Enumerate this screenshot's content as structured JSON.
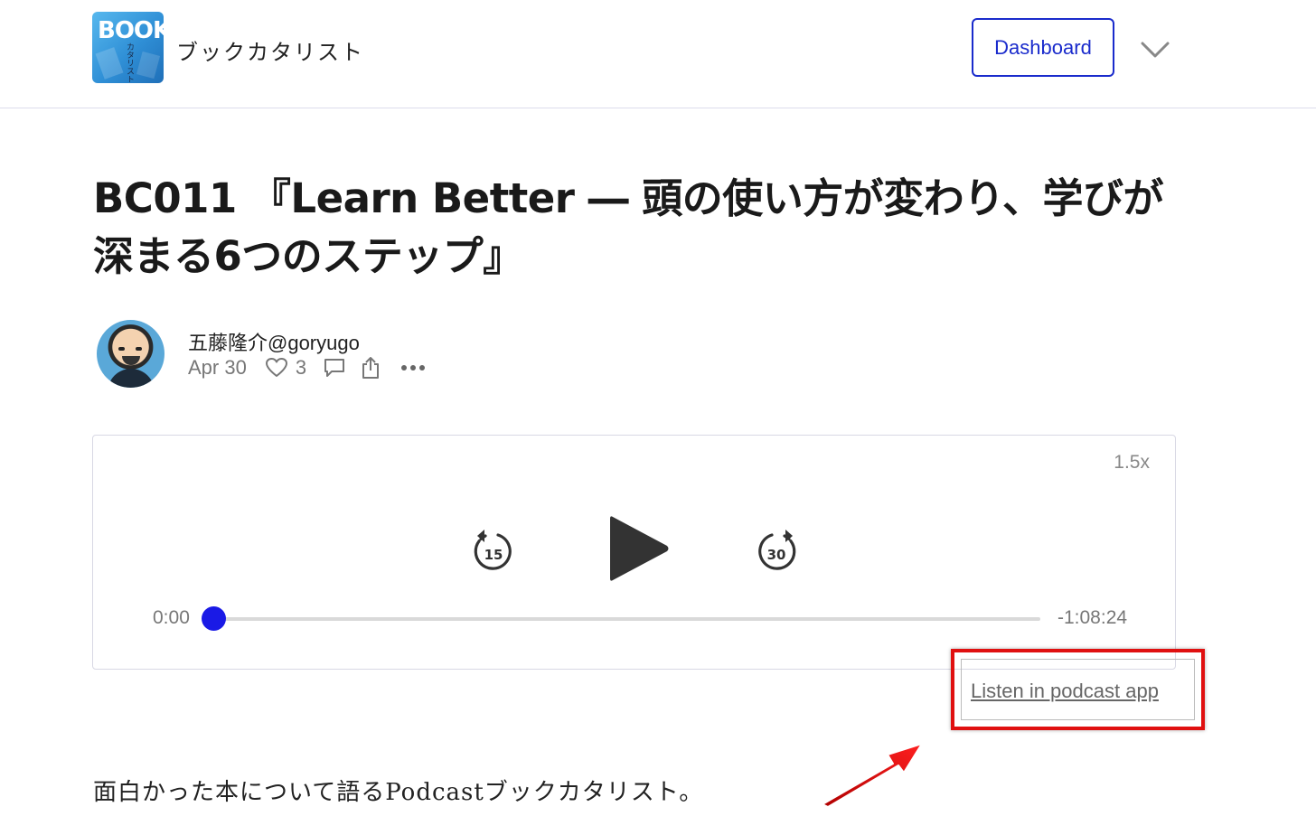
{
  "header": {
    "logo_text": "BOOK",
    "logo_sub": "カタリスト",
    "site_name": "ブックカタリスト",
    "dashboard_label": "Dashboard"
  },
  "post": {
    "title": "BC011 『Learn Better ― 頭の使い方が変わり、学びが深まる6つのステップ』",
    "author": "五藤隆介@goryugo",
    "date": "Apr 30",
    "like_count": "3"
  },
  "player": {
    "speed": "1.5x",
    "skip_back_seconds": "15",
    "skip_forward_seconds": "30",
    "current_time": "0:00",
    "remaining_time": "-1:08:24",
    "progress": 0
  },
  "podcast_link": "Listen in podcast app",
  "body_text": "面白かった本について語るPodcastブックカタリスト。",
  "colors": {
    "accent": "#1a2bcc",
    "thumb": "#1a1ae6",
    "highlight": "#e01010"
  }
}
